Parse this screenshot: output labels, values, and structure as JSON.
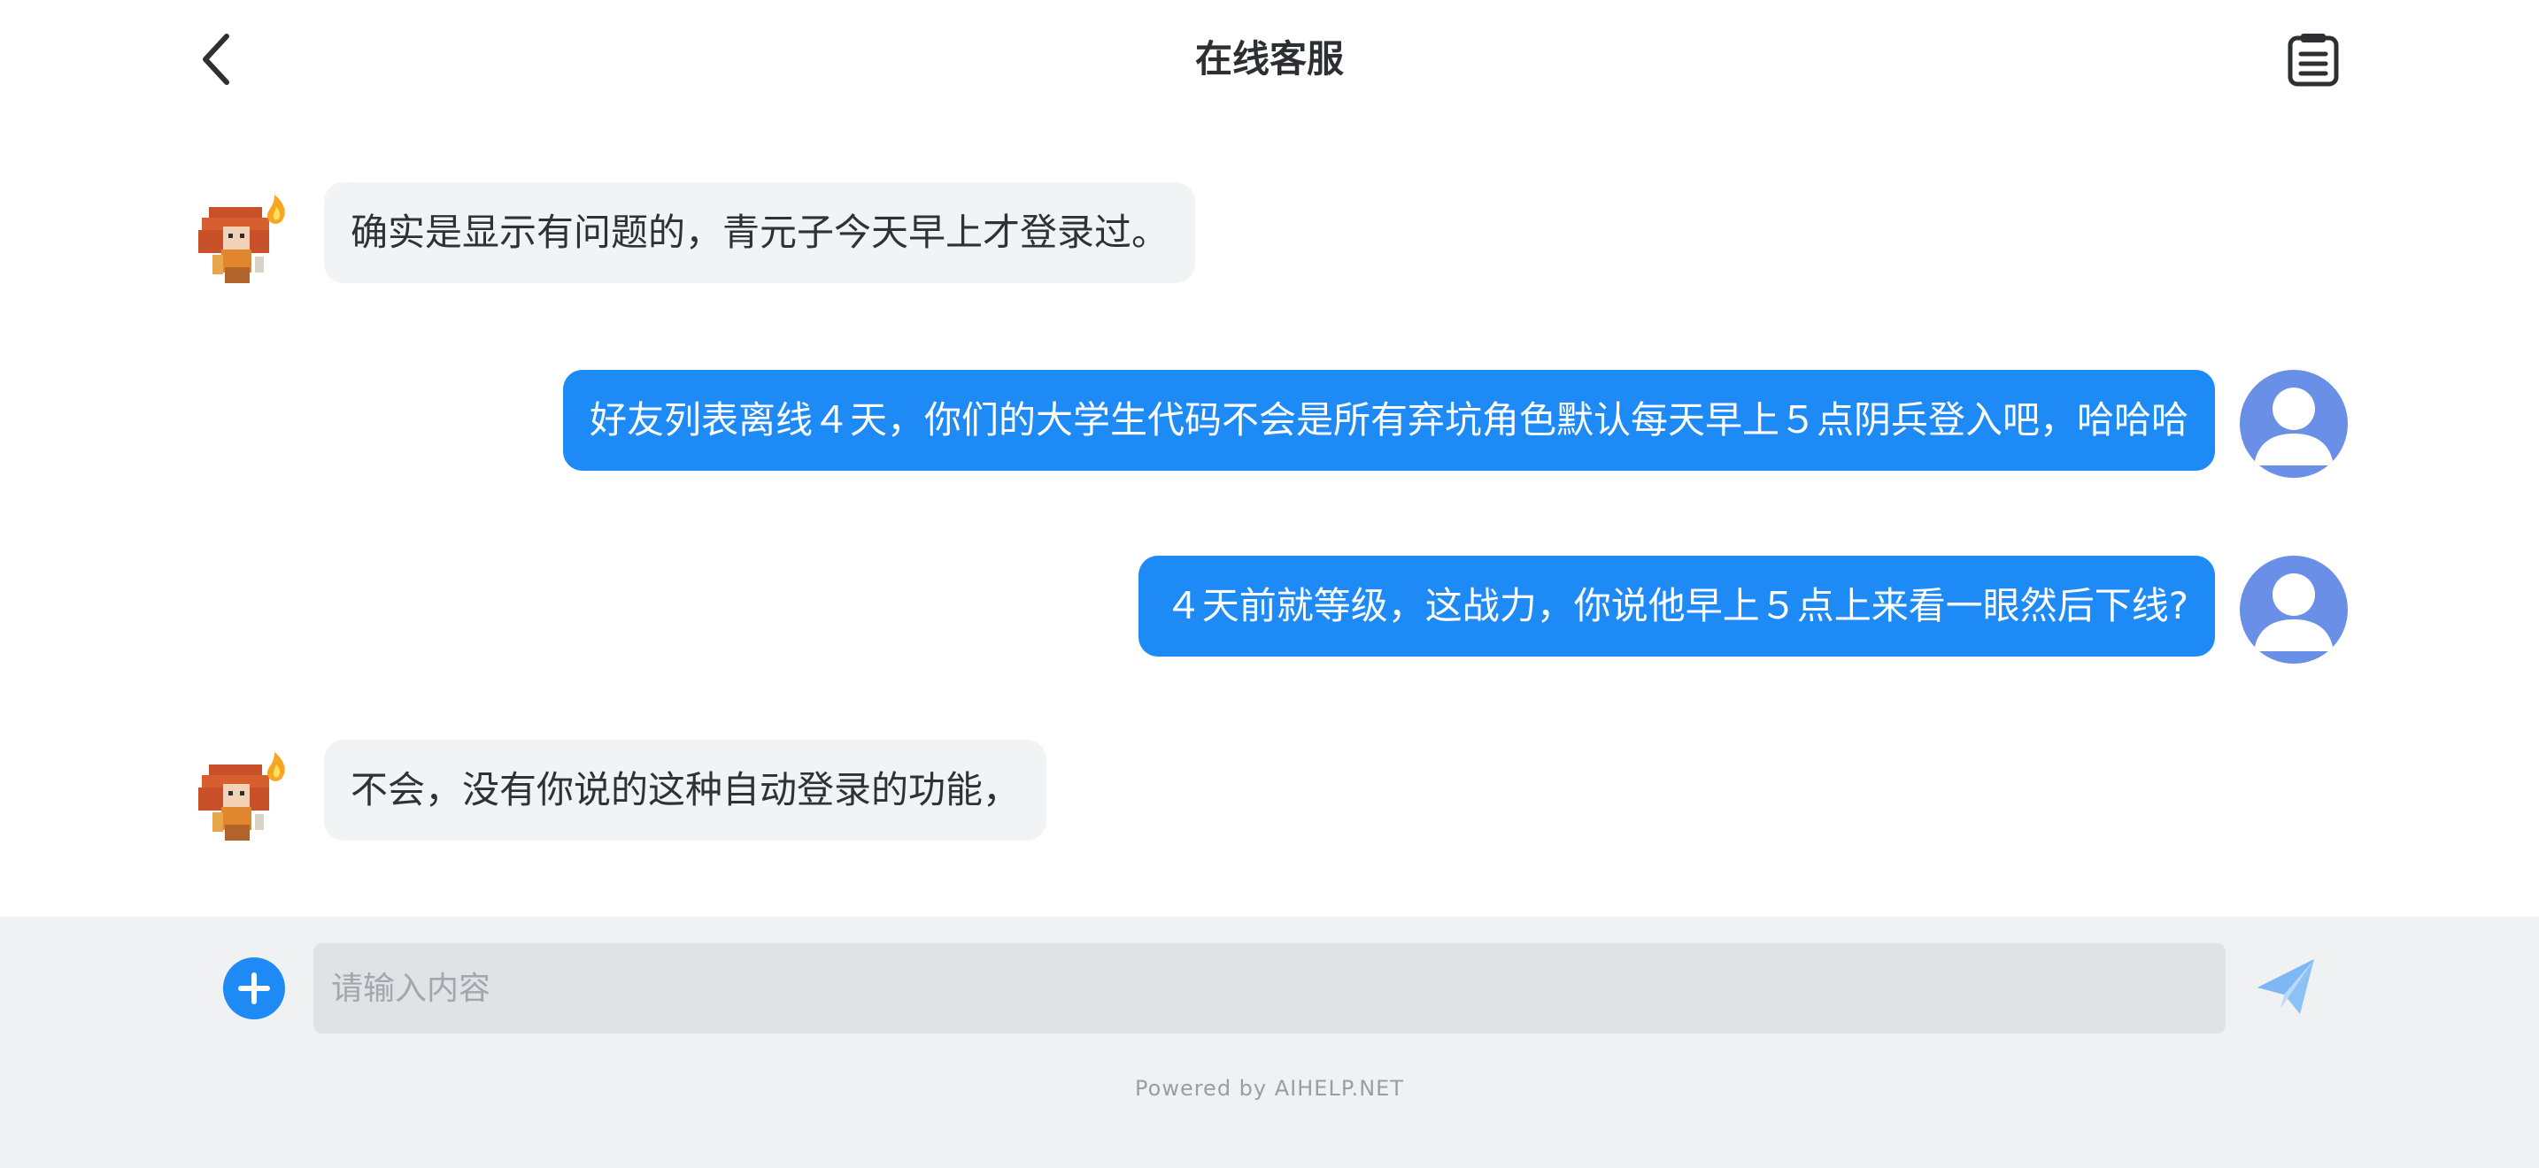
{
  "header": {
    "title": "在线客服",
    "back_icon": "chevron-left-icon",
    "ticket_icon": "clipboard-list-icon"
  },
  "messages": [
    {
      "sender": "agent",
      "text": "确实是显示有问题的，青元子今天早上才登录过。"
    },
    {
      "sender": "user",
      "text": "好友列表离线４天，你们的大学生代码不会是所有弃坑角色默认每天早上５点阴兵登入吧，哈哈哈"
    },
    {
      "sender": "user",
      "text": "４天前就等级，这战力，你说他早上５点上来看一眼然后下线?"
    },
    {
      "sender": "agent",
      "text": "不会，没有你说的这种自动登录的功能，"
    }
  ],
  "composer": {
    "placeholder": "请输入内容",
    "value": "",
    "add_icon": "plus-circle-icon",
    "send_icon": "paper-plane-icon"
  },
  "footer": {
    "powered_by": "Powered by AIHELP.NET"
  },
  "colors": {
    "accent": "#1e8af6",
    "agent_bubble": "#f2f3f5",
    "user_avatar": "#6a8fe6",
    "footer_bg": "#f0f1f3"
  }
}
